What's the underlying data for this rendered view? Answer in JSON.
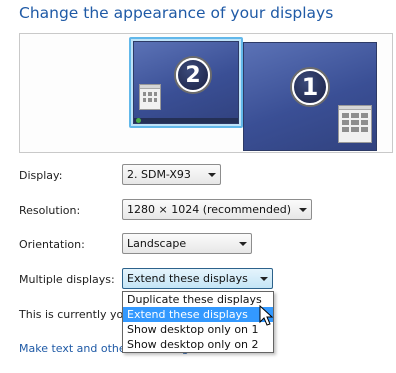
{
  "title": "Change the appearance of your displays",
  "preview": {
    "monitor_2_number": "2",
    "monitor_1_number": "1",
    "selected_monitor": "2"
  },
  "fields": {
    "display_label": "Display:",
    "display_value": "2. SDM-X93",
    "resolution_label": "Resolution:",
    "resolution_value": "1280 × 1024 (recommended)",
    "orientation_label": "Orientation:",
    "orientation_value": "Landscape",
    "multiple_label": "Multiple displays:",
    "multiple_value": "Extend these displays"
  },
  "multiple_options": [
    "Duplicate these displays",
    "Extend these displays",
    "Show desktop only on 1",
    "Show desktop only on 2"
  ],
  "selected_option_index": 1,
  "info_text": "This is currently you",
  "link_text": "Make text and other items larger or smaller",
  "colors": {
    "accent": "#1f5aa6",
    "selection": "#3399ff",
    "monitor_selected_frame": "#62b8ea"
  }
}
